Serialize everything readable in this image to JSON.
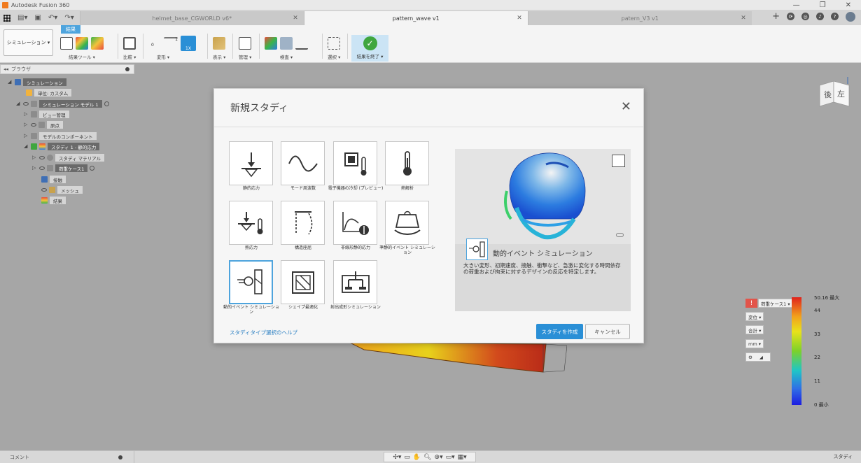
{
  "app": {
    "title": "Autodesk Fusion 360"
  },
  "tabs": [
    {
      "label": "helmet_base_CGWORLD v6*"
    },
    {
      "label": "pattern_wave v1"
    },
    {
      "label": "patern_V3 v1"
    }
  ],
  "toolbar": {
    "workspace": "シミュレーション ▾",
    "active_tab": "結果",
    "groups": {
      "result_tools": "結果ツール ▾",
      "compare": "比較 ▾",
      "deform": "変形 ▾",
      "display": "表示 ▾",
      "manage": "管理 ▾",
      "inspect": "検査 ▾",
      "select": "選択 ▾",
      "finish": "結果を終了 ▾"
    },
    "deform_scale": "1X",
    "deform_zero": "0",
    "deform_one": "1"
  },
  "browser": {
    "title": "ブラウザ",
    "items": [
      {
        "label": "シミュレーション"
      },
      {
        "label": "単位: カスタム"
      },
      {
        "label": "シミュレーション モデル 1"
      },
      {
        "label": "ビュー管理"
      },
      {
        "label": "原点"
      },
      {
        "label": "モデルのコンポーネント"
      },
      {
        "label": "スタディ 1 - 静的応力"
      },
      {
        "label": "スタディ マテリアル"
      },
      {
        "label": "荷重ケース1"
      },
      {
        "label": "接触"
      },
      {
        "label": "メッシュ"
      },
      {
        "label": "結果"
      }
    ]
  },
  "dialog": {
    "title": "新規スタディ",
    "tiles": [
      {
        "label": "静的応力"
      },
      {
        "label": "モード周波数"
      },
      {
        "label": "電子機器の冷却 (プレビュー)"
      },
      {
        "label": "熱解析"
      },
      {
        "label": "熱応力"
      },
      {
        "label": "構造座屈"
      },
      {
        "label": "非線形静的応力"
      },
      {
        "label": "準静的イベント シミュレーション"
      },
      {
        "label": "動的イベント シミュレーション"
      },
      {
        "label": "シェイプ最適化"
      },
      {
        "label": "射出成形シミュレーション"
      }
    ],
    "preview_title": "動的イベント シミュレーション",
    "preview_desc": "大きい変形、初期速度、接触、衝撃など、急激に変化する時間依存の荷重および拘束に対するデザインの反応を特定します。",
    "help_link": "スタディタイプ選択のヘルプ",
    "create_button": "スタディを作成",
    "cancel_button": "キャンセル"
  },
  "legend": {
    "load_case": "荷重ケース1 ▾",
    "result_type": "変位 ▾",
    "component": "合計 ▾",
    "unit": "mm ▾",
    "ticks": [
      "50.16 最大",
      "44",
      "33",
      "22",
      "11",
      "0 最小"
    ]
  },
  "viewcube": {
    "face_back": "後",
    "face_left": "左"
  },
  "bottom": {
    "comment": "コメント",
    "status": "スタディ"
  },
  "colors": {
    "accent": "#2a8fd6",
    "finish_green": "#3fa63f"
  }
}
